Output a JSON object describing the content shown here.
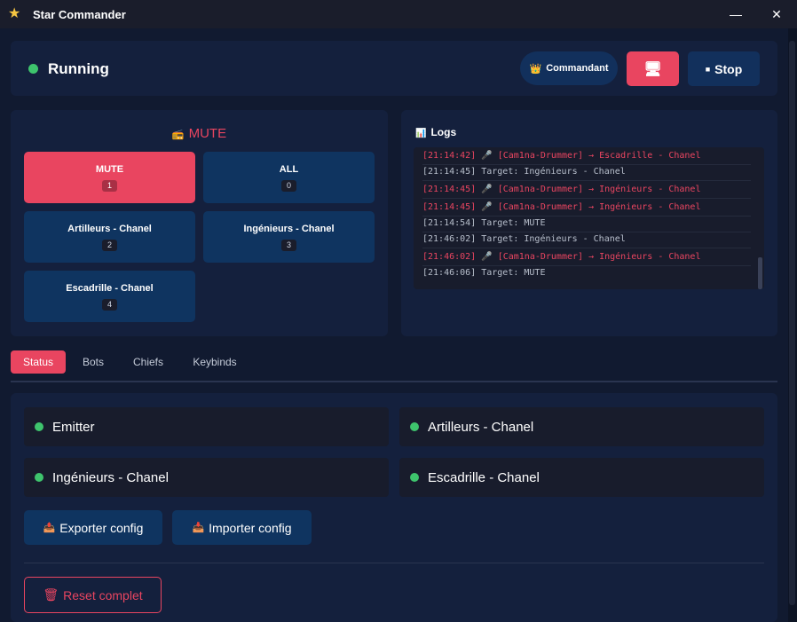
{
  "window": {
    "title": "Star Commander",
    "minimize": "—",
    "close": "✕"
  },
  "header": {
    "status": "Running",
    "commandant_icon": "👑",
    "commandant_label": "Commandant",
    "monitor_icon": "🖥",
    "stop_icon": "■",
    "stop_label": "Stop"
  },
  "targets": {
    "title_icon": "📻",
    "title": "MUTE",
    "items": [
      {
        "label": "MUTE",
        "key": "1",
        "active": true
      },
      {
        "label": "ALL",
        "key": "0",
        "active": false
      },
      {
        "label": "Artilleurs - Chanel",
        "key": "2",
        "active": false
      },
      {
        "label": "Ingénieurs - Chanel",
        "key": "3",
        "active": false
      },
      {
        "label": "Escadrille - Chanel",
        "key": "4",
        "active": false
      }
    ]
  },
  "logs": {
    "title_icon": "📊",
    "title": "Logs",
    "lines": [
      {
        "text": "[21:14:42] 🎤 [Cam1na-Drummer] → Escadrille - Chanel",
        "highlight": true
      },
      {
        "text": "[21:14:45] Target: Ingénieurs - Chanel",
        "highlight": false
      },
      {
        "text": "[21:14:45] 🎤 [Cam1na-Drummer] → Ingénieurs - Chanel",
        "highlight": true
      },
      {
        "text": "[21:14:45] 🎤 [Cam1na-Drummer] → Ingénieurs - Chanel",
        "highlight": true
      },
      {
        "text": "[21:14:54] Target: MUTE",
        "highlight": false
      },
      {
        "text": "[21:46:02] Target: Ingénieurs - Chanel",
        "highlight": false
      },
      {
        "text": "[21:46:02] 🎤 [Cam1na-Drummer] → Ingénieurs - Chanel",
        "highlight": true
      },
      {
        "text": "[21:46:06] Target: MUTE",
        "highlight": false
      }
    ]
  },
  "tabs": [
    {
      "label": "Status",
      "active": true
    },
    {
      "label": "Bots",
      "active": false
    },
    {
      "label": "Chiefs",
      "active": false
    },
    {
      "label": "Keybinds",
      "active": false
    }
  ],
  "status_panel": {
    "items": [
      "Emitter",
      "Artilleurs - Chanel",
      "Ingénieurs - Chanel",
      "Escadrille - Chanel"
    ],
    "export_icon": "📤",
    "export_label": "Exporter config",
    "import_icon": "📥",
    "import_label": "Importer config",
    "reset_icon": "🗑",
    "reset_label": "Reset complet"
  },
  "colors": {
    "accent": "#e94560",
    "status_ok": "#3ec46d",
    "button": "#0f3460",
    "panel": "#14203d"
  }
}
